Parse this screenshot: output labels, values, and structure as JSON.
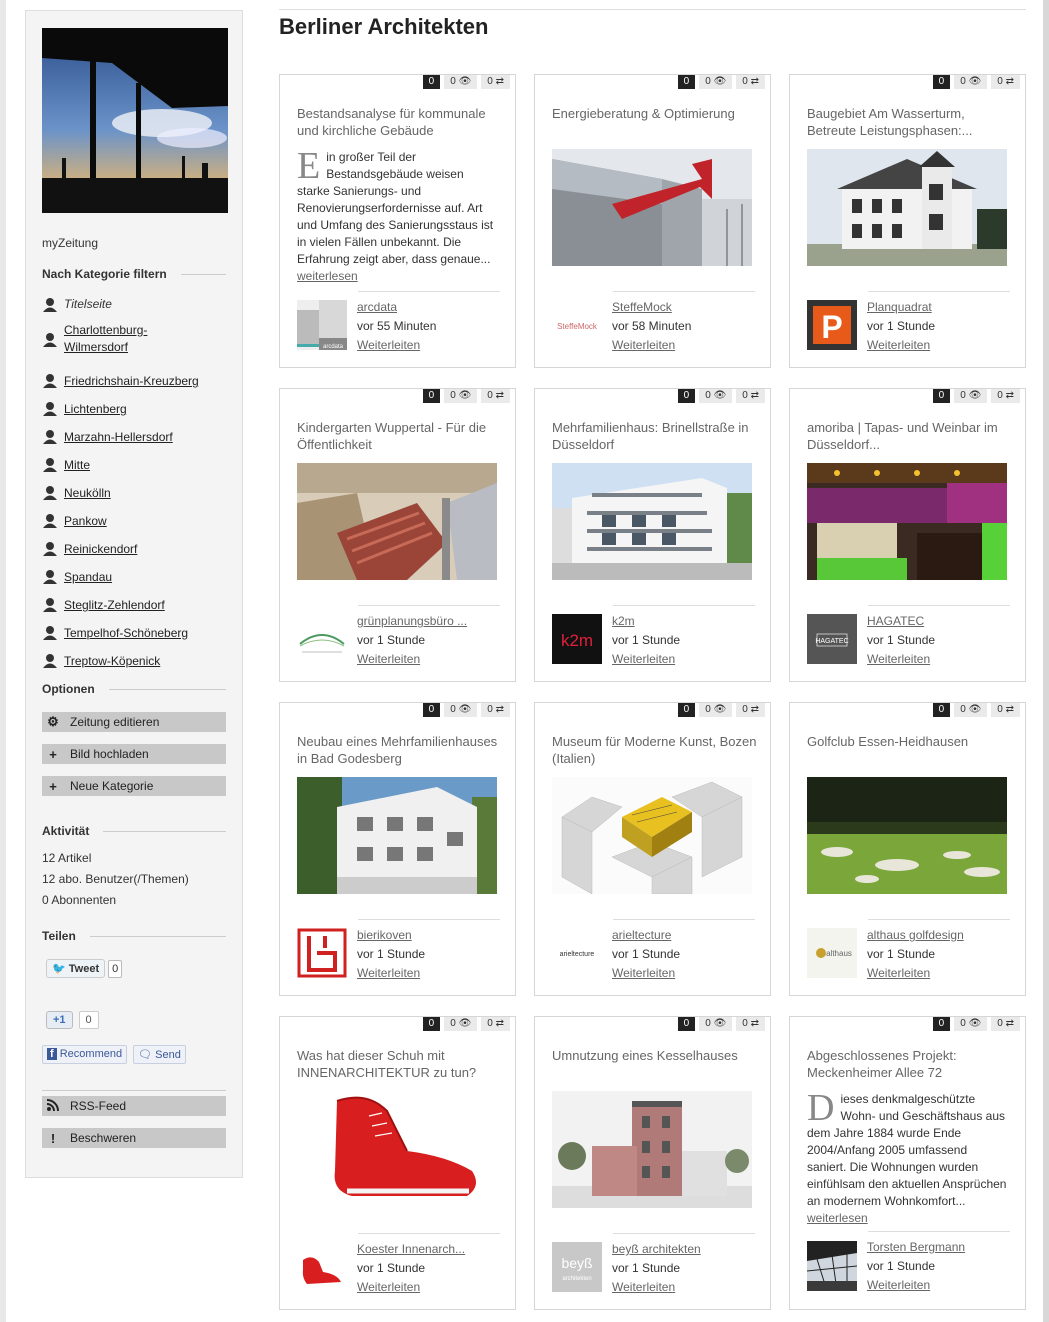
{
  "page_title": "Berliner Architekten",
  "sidebar": {
    "title": "myZeitung",
    "filter_heading": "Nach Kategorie filtern",
    "categories": [
      "Titelseite",
      "Charlottenburg-Wilmersdorf",
      "Friedrichshain-Kreuzberg",
      "Lichtenberg",
      "Marzahn-Hellersdorf",
      "Mitte",
      "Neukölln",
      "Pankow",
      "Reinickendorf",
      "Spandau",
      "Steglitz-Zehlendorf",
      "Tempelhof-Schöneberg",
      "Treptow-Köpenick"
    ],
    "options_heading": "Optionen",
    "options": [
      {
        "icon": "gear-icon",
        "label": "Zeitung editieren"
      },
      {
        "icon": "plus-icon",
        "label": "Bild hochladen"
      },
      {
        "icon": "plus-icon",
        "label": "Neue Kategorie"
      }
    ],
    "activity_heading": "Aktivität",
    "activity": [
      "12 Artikel",
      "12 abo. Benutzer(/Themen)",
      "0 Abonnenten"
    ],
    "share_heading": "Teilen",
    "tweet_label": "Tweet",
    "tweet_count": "0",
    "gplus_label": "+1",
    "gplus_count": "0",
    "recommend_label": "Recommend",
    "send_label": "Send",
    "rss_label": "RSS-Feed",
    "complain_label": "Beschweren"
  },
  "cards": [
    {
      "title": "Bestandsanalyse für kommunale und kirchliche Gebäude",
      "text_drop": "E",
      "text": "in großer Teil der Bestandsgebäude weisen starke Sanierungs- und Renovierungserfordernisse auf. Art und Umfang des Sanierungsstaus ist in vielen Fällen unbekannt. Die Erfahrung zeigt aber, dass genaue...",
      "read_more": "weiterlesen",
      "source": "arcdata",
      "time": "vor 55 Minuten",
      "forward": "Weiterleiten",
      "comments": "0",
      "views": "0",
      "shares": "0"
    },
    {
      "title": "Energieberatung & Optimierung",
      "source": "SteffeMock",
      "time": "vor 58 Minuten",
      "forward": "Weiterleiten",
      "comments": "0",
      "views": "0",
      "shares": "0"
    },
    {
      "title": "Baugebiet Am Wasserturm, Betreute Leistungsphasen:...",
      "source": "Planquadrat",
      "time": "vor 1 Stunde",
      "forward": "Weiterleiten",
      "comments": "0",
      "views": "0",
      "shares": "0"
    },
    {
      "title": "Kindergarten Wuppertal - Für die Öffentlichkeit",
      "source": "grünplanungsbüro ...",
      "time": "vor 1 Stunde",
      "forward": "Weiterleiten",
      "comments": "0",
      "views": "0",
      "shares": "0"
    },
    {
      "title": "Mehrfamilienhaus: Brinellstraße in Düsseldorf",
      "source": "k2m",
      "time": "vor 1 Stunde",
      "forward": "Weiterleiten",
      "comments": "0",
      "views": "0",
      "shares": "0"
    },
    {
      "title": "amoriba | Tapas- und Weinbar im Düsseldorf...",
      "source": "HAGATEC",
      "time": "vor 1 Stunde",
      "forward": "Weiterleiten",
      "comments": "0",
      "views": "0",
      "shares": "0"
    },
    {
      "title": "Neubau eines Mehrfamilienhauses in Bad Godesberg",
      "source": "bierikoven",
      "time": "vor 1 Stunde",
      "forward": "Weiterleiten",
      "comments": "0",
      "views": "0",
      "shares": "0"
    },
    {
      "title": "Museum für Moderne Kunst, Bozen (Italien)",
      "source": "arieltecture",
      "time": "vor 1 Stunde",
      "forward": "Weiterleiten",
      "comments": "0",
      "views": "0",
      "shares": "0"
    },
    {
      "title": "Golfclub Essen-Heidhausen",
      "source": "althaus golfdesign",
      "time": "vor 1 Stunde",
      "forward": "Weiterleiten",
      "comments": "0",
      "views": "0",
      "shares": "0"
    },
    {
      "title": "Was hat dieser Schuh mit INNENARCHITEKTUR zu tun?",
      "source": "Koester Innenarch...",
      "time": "vor 1 Stunde",
      "forward": "Weiterleiten",
      "comments": "0",
      "views": "0",
      "shares": "0"
    },
    {
      "title": "Umnutzung eines Kesselhauses",
      "source": "beyß architekten",
      "time": "vor 1 Stunde",
      "forward": "Weiterleiten",
      "comments": "0",
      "views": "0",
      "shares": "0"
    },
    {
      "title": "Abgeschlossenes Projekt: Meckenheimer Allee 72",
      "text_drop": "D",
      "text": "ieses denkmalgeschützte Wohn- und Geschäftshaus aus dem Jahre 1884 wurde Ende 2004/Anfang 2005 umfassend saniert. Die Wohnungen wurden einfühlsam den aktuellen Ansprüchen an modernem Wohnkomfort...",
      "read_more": "weiterlesen",
      "source": "Torsten Bergmann",
      "time": "vor 1 Stunde",
      "forward": "Weiterleiten",
      "comments": "0",
      "views": "0",
      "shares": "0"
    }
  ],
  "logo_texts": {
    "arcdata": "arcdata",
    "steffemock": "SteffeMock",
    "k2m": "k2m",
    "hagatec": "HAGATEC",
    "arieltecture": "arieltecture",
    "althaus": "althaus",
    "beyss": "beyß",
    "beyss_sub": "architekten"
  }
}
